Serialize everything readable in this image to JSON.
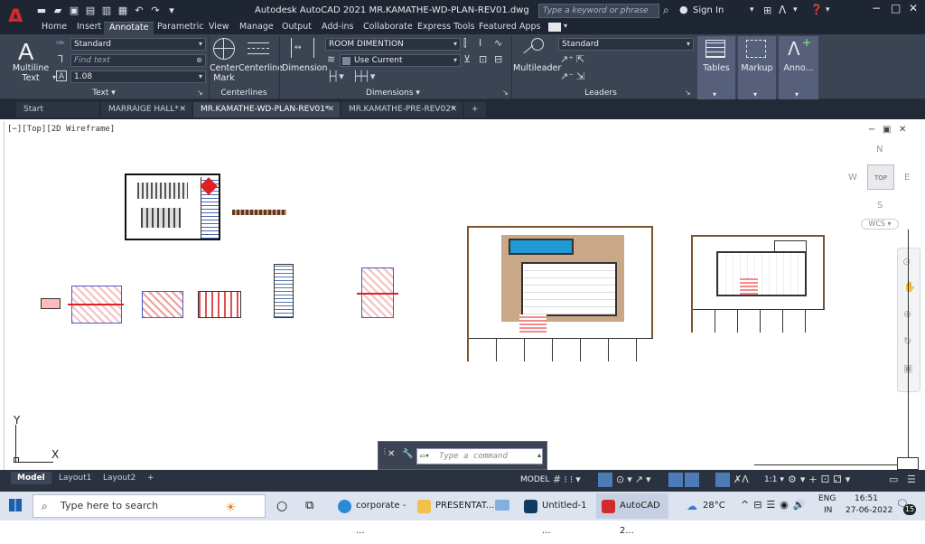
{
  "app": {
    "title": "Autodesk AutoCAD 2021    MR.KAMATHE-WD-PLAN-REV01.dwg",
    "search_placeholder": "Type a keyword or phrase",
    "sign_in": "Sign In"
  },
  "ribbon_tabs": [
    "Home",
    "Insert",
    "Annotate",
    "Parametric",
    "View",
    "Manage",
    "Output",
    "Add-ins",
    "Collaborate",
    "Express Tools",
    "Featured Apps"
  ],
  "active_ribbon_tab": "Annotate",
  "ribbon": {
    "text_panel": {
      "title": "Text ▾",
      "multiline_label1": "Multiline",
      "multiline_label2": "Text",
      "style_value": "Standard",
      "find_placeholder": "Find text",
      "height_value": "1.08"
    },
    "centerlines_panel": {
      "title": "Centerlines",
      "center_mark1": "Center",
      "center_mark2": "Mark",
      "centerline": "Centerline"
    },
    "dimensions_panel": {
      "title": "Dimensions ▾",
      "dimension": "Dimension",
      "dim_style": "ROOM DIMENTION",
      "layer": "Use Current"
    },
    "leaders_panel": {
      "title": "Leaders",
      "multileader": "Multileader",
      "leader_style": "Standard"
    },
    "tables_label": "Tables",
    "markup_label": "Markup",
    "anno_label": "Anno..."
  },
  "doc_tabs": [
    {
      "label": "Start",
      "active": false,
      "closable": false
    },
    {
      "label": "MARRAIGE HALL*",
      "active": false,
      "closable": true
    },
    {
      "label": "MR.KAMATHE-WD-PLAN-REV01*",
      "active": true,
      "closable": true
    },
    {
      "label": "MR.KAMATHE-PRE-REV02*",
      "active": false,
      "closable": true
    }
  ],
  "canvas": {
    "view_label": "[−][Top][2D Wireframe]",
    "viewcube": {
      "n": "N",
      "s": "S",
      "e": "E",
      "w": "W",
      "top": "TOP",
      "wcs": "WCS ▾"
    },
    "ucs": {
      "x": "X",
      "y": "Y"
    }
  },
  "command": {
    "placeholder": "Type a command"
  },
  "layout_tabs": [
    "Model",
    "Layout1",
    "Layout2"
  ],
  "status": {
    "model": "MODEL",
    "scale": "1:1 ▾"
  },
  "taskbar": {
    "search": "Type here to search",
    "apps": [
      "corporate - ...",
      "PRESENTAT...",
      "Untitled-1 ...",
      "AutoCAD 2..."
    ],
    "weather": "28°C",
    "lang1": "ENG",
    "lang2": "IN",
    "time": "16:51",
    "date": "27-06-2022",
    "notif": "15"
  },
  "colors": {
    "ribbon_bg": "#3b4453",
    "title_bg": "#1e2634",
    "accent_red": "#d32a2a"
  }
}
